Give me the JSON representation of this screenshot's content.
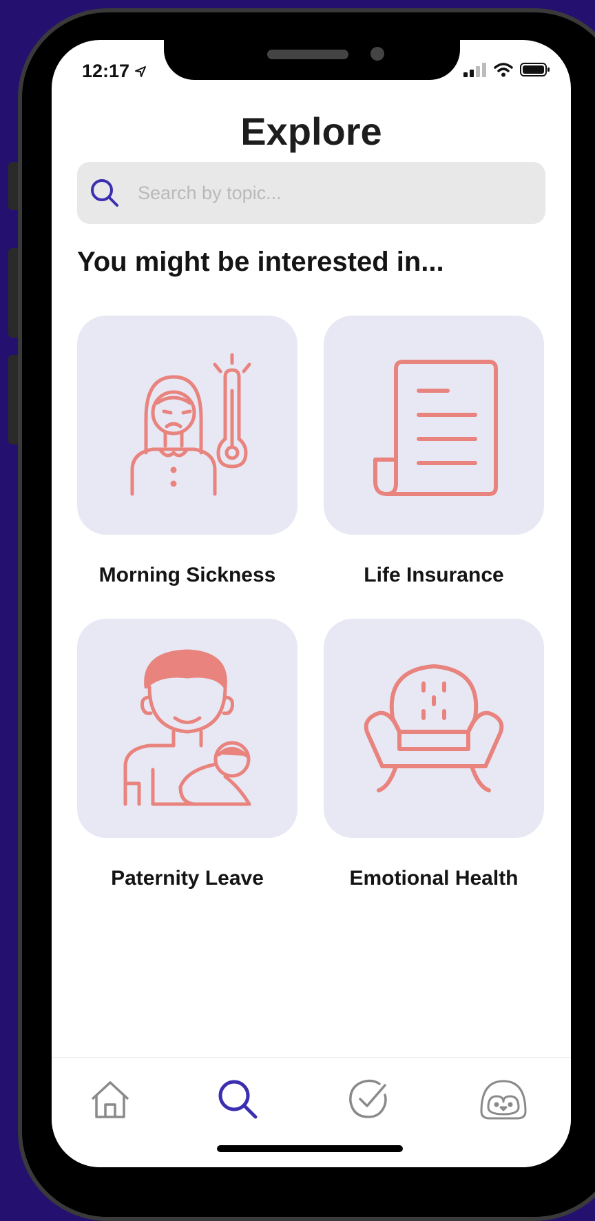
{
  "status_bar": {
    "time": "12:17"
  },
  "page": {
    "title": "Explore"
  },
  "search": {
    "placeholder": "Search by topic..."
  },
  "section": {
    "heading": "You might be interested in..."
  },
  "topics": [
    {
      "label": "Morning Sickness",
      "icon": "sick-woman-thermometer-icon"
    },
    {
      "label": "Life Insurance",
      "icon": "document-scroll-icon"
    },
    {
      "label": "Paternity Leave",
      "icon": "father-holding-baby-icon"
    },
    {
      "label": "Emotional Health",
      "icon": "armchair-icon"
    }
  ],
  "tabbar": {
    "items": [
      "home-icon",
      "search-icon",
      "check-circle-icon",
      "penguin-profile-icon"
    ],
    "active": "search-icon"
  },
  "colors": {
    "background": "#23106f",
    "accent": "#3b2fb0",
    "illustration": "#e8837d",
    "card": "#e8e8f5",
    "search_field": "#e8e8e8"
  }
}
